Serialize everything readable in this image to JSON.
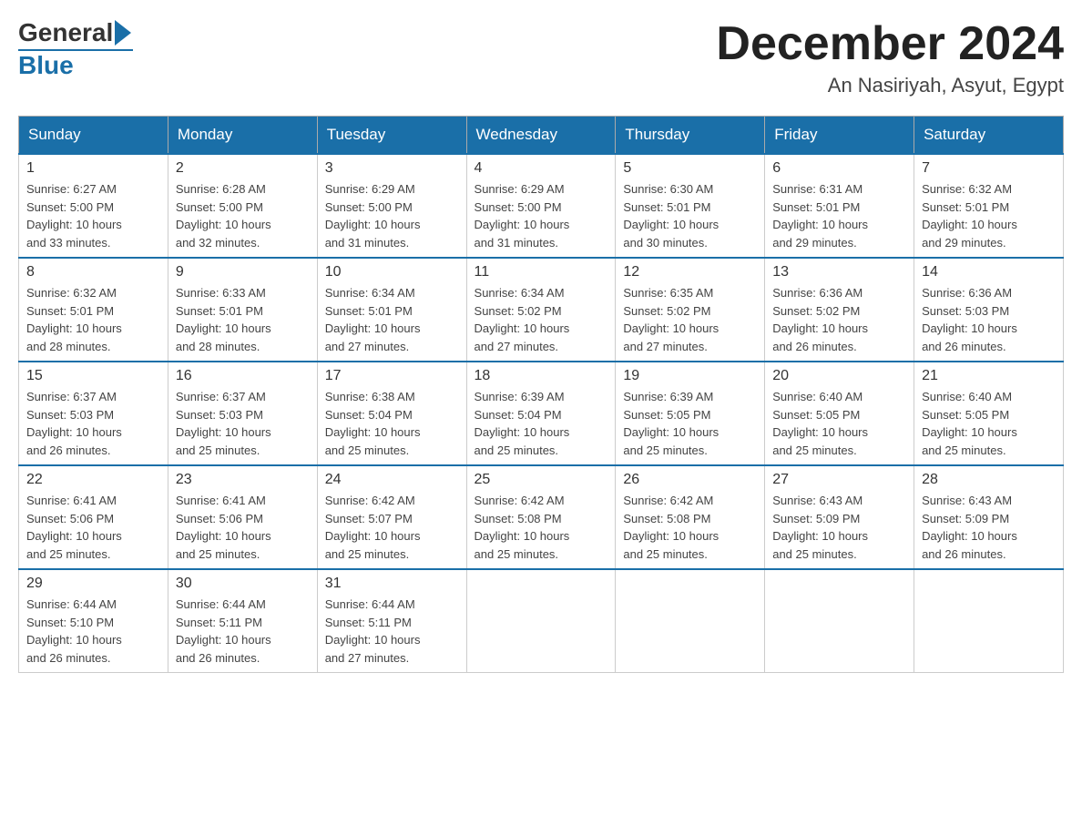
{
  "header": {
    "logo_general": "General",
    "logo_blue": "Blue",
    "month_title": "December 2024",
    "subtitle": "An Nasiriyah, Asyut, Egypt"
  },
  "days_of_week": [
    "Sunday",
    "Monday",
    "Tuesday",
    "Wednesday",
    "Thursday",
    "Friday",
    "Saturday"
  ],
  "weeks": [
    [
      {
        "day": "1",
        "sunrise": "6:27 AM",
        "sunset": "5:00 PM",
        "daylight": "10 hours and 33 minutes."
      },
      {
        "day": "2",
        "sunrise": "6:28 AM",
        "sunset": "5:00 PM",
        "daylight": "10 hours and 32 minutes."
      },
      {
        "day": "3",
        "sunrise": "6:29 AM",
        "sunset": "5:00 PM",
        "daylight": "10 hours and 31 minutes."
      },
      {
        "day": "4",
        "sunrise": "6:29 AM",
        "sunset": "5:00 PM",
        "daylight": "10 hours and 31 minutes."
      },
      {
        "day": "5",
        "sunrise": "6:30 AM",
        "sunset": "5:01 PM",
        "daylight": "10 hours and 30 minutes."
      },
      {
        "day": "6",
        "sunrise": "6:31 AM",
        "sunset": "5:01 PM",
        "daylight": "10 hours and 29 minutes."
      },
      {
        "day": "7",
        "sunrise": "6:32 AM",
        "sunset": "5:01 PM",
        "daylight": "10 hours and 29 minutes."
      }
    ],
    [
      {
        "day": "8",
        "sunrise": "6:32 AM",
        "sunset": "5:01 PM",
        "daylight": "10 hours and 28 minutes."
      },
      {
        "day": "9",
        "sunrise": "6:33 AM",
        "sunset": "5:01 PM",
        "daylight": "10 hours and 28 minutes."
      },
      {
        "day": "10",
        "sunrise": "6:34 AM",
        "sunset": "5:01 PM",
        "daylight": "10 hours and 27 minutes."
      },
      {
        "day": "11",
        "sunrise": "6:34 AM",
        "sunset": "5:02 PM",
        "daylight": "10 hours and 27 minutes."
      },
      {
        "day": "12",
        "sunrise": "6:35 AM",
        "sunset": "5:02 PM",
        "daylight": "10 hours and 27 minutes."
      },
      {
        "day": "13",
        "sunrise": "6:36 AM",
        "sunset": "5:02 PM",
        "daylight": "10 hours and 26 minutes."
      },
      {
        "day": "14",
        "sunrise": "6:36 AM",
        "sunset": "5:03 PM",
        "daylight": "10 hours and 26 minutes."
      }
    ],
    [
      {
        "day": "15",
        "sunrise": "6:37 AM",
        "sunset": "5:03 PM",
        "daylight": "10 hours and 26 minutes."
      },
      {
        "day": "16",
        "sunrise": "6:37 AM",
        "sunset": "5:03 PM",
        "daylight": "10 hours and 25 minutes."
      },
      {
        "day": "17",
        "sunrise": "6:38 AM",
        "sunset": "5:04 PM",
        "daylight": "10 hours and 25 minutes."
      },
      {
        "day": "18",
        "sunrise": "6:39 AM",
        "sunset": "5:04 PM",
        "daylight": "10 hours and 25 minutes."
      },
      {
        "day": "19",
        "sunrise": "6:39 AM",
        "sunset": "5:05 PM",
        "daylight": "10 hours and 25 minutes."
      },
      {
        "day": "20",
        "sunrise": "6:40 AM",
        "sunset": "5:05 PM",
        "daylight": "10 hours and 25 minutes."
      },
      {
        "day": "21",
        "sunrise": "6:40 AM",
        "sunset": "5:05 PM",
        "daylight": "10 hours and 25 minutes."
      }
    ],
    [
      {
        "day": "22",
        "sunrise": "6:41 AM",
        "sunset": "5:06 PM",
        "daylight": "10 hours and 25 minutes."
      },
      {
        "day": "23",
        "sunrise": "6:41 AM",
        "sunset": "5:06 PM",
        "daylight": "10 hours and 25 minutes."
      },
      {
        "day": "24",
        "sunrise": "6:42 AM",
        "sunset": "5:07 PM",
        "daylight": "10 hours and 25 minutes."
      },
      {
        "day": "25",
        "sunrise": "6:42 AM",
        "sunset": "5:08 PM",
        "daylight": "10 hours and 25 minutes."
      },
      {
        "day": "26",
        "sunrise": "6:42 AM",
        "sunset": "5:08 PM",
        "daylight": "10 hours and 25 minutes."
      },
      {
        "day": "27",
        "sunrise": "6:43 AM",
        "sunset": "5:09 PM",
        "daylight": "10 hours and 25 minutes."
      },
      {
        "day": "28",
        "sunrise": "6:43 AM",
        "sunset": "5:09 PM",
        "daylight": "10 hours and 26 minutes."
      }
    ],
    [
      {
        "day": "29",
        "sunrise": "6:44 AM",
        "sunset": "5:10 PM",
        "daylight": "10 hours and 26 minutes."
      },
      {
        "day": "30",
        "sunrise": "6:44 AM",
        "sunset": "5:11 PM",
        "daylight": "10 hours and 26 minutes."
      },
      {
        "day": "31",
        "sunrise": "6:44 AM",
        "sunset": "5:11 PM",
        "daylight": "10 hours and 27 minutes."
      },
      null,
      null,
      null,
      null
    ]
  ],
  "labels": {
    "sunrise_prefix": "Sunrise: ",
    "sunset_prefix": "Sunset: ",
    "daylight_prefix": "Daylight: "
  }
}
